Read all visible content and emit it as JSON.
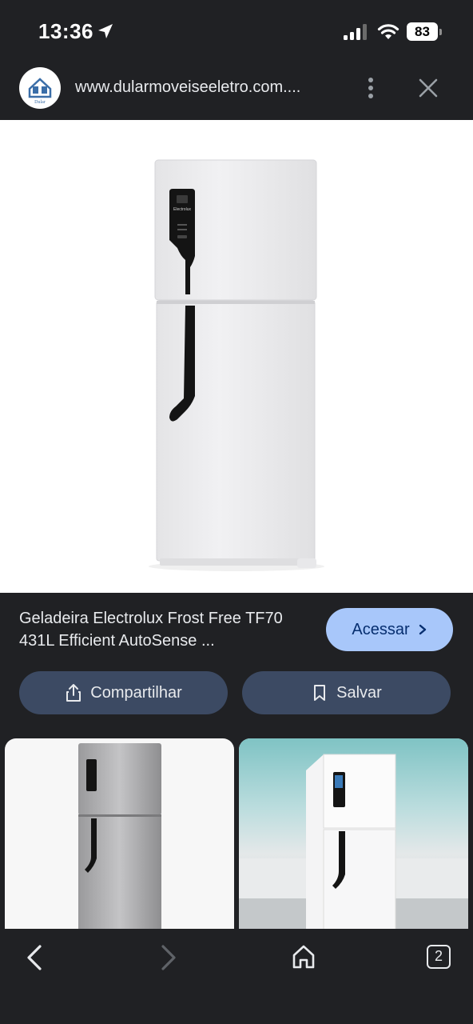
{
  "status_bar": {
    "time": "13:36",
    "battery_level": "83"
  },
  "browser": {
    "url": "www.dularmoveiseeletro.com....",
    "site_logo_text": "Dular"
  },
  "product": {
    "title": "Geladeira Electrolux Frost Free TF70 431L Efficient AutoSense ...",
    "brand_on_panel": "Electrolux",
    "access_label": "Acessar",
    "share_label": "Compartilhar",
    "save_label": "Salvar"
  },
  "bottom_nav": {
    "tab_count": "2"
  },
  "colors": {
    "background": "#202124",
    "accent_button": "#a8c7fa",
    "pill_button": "#3c4a63"
  }
}
